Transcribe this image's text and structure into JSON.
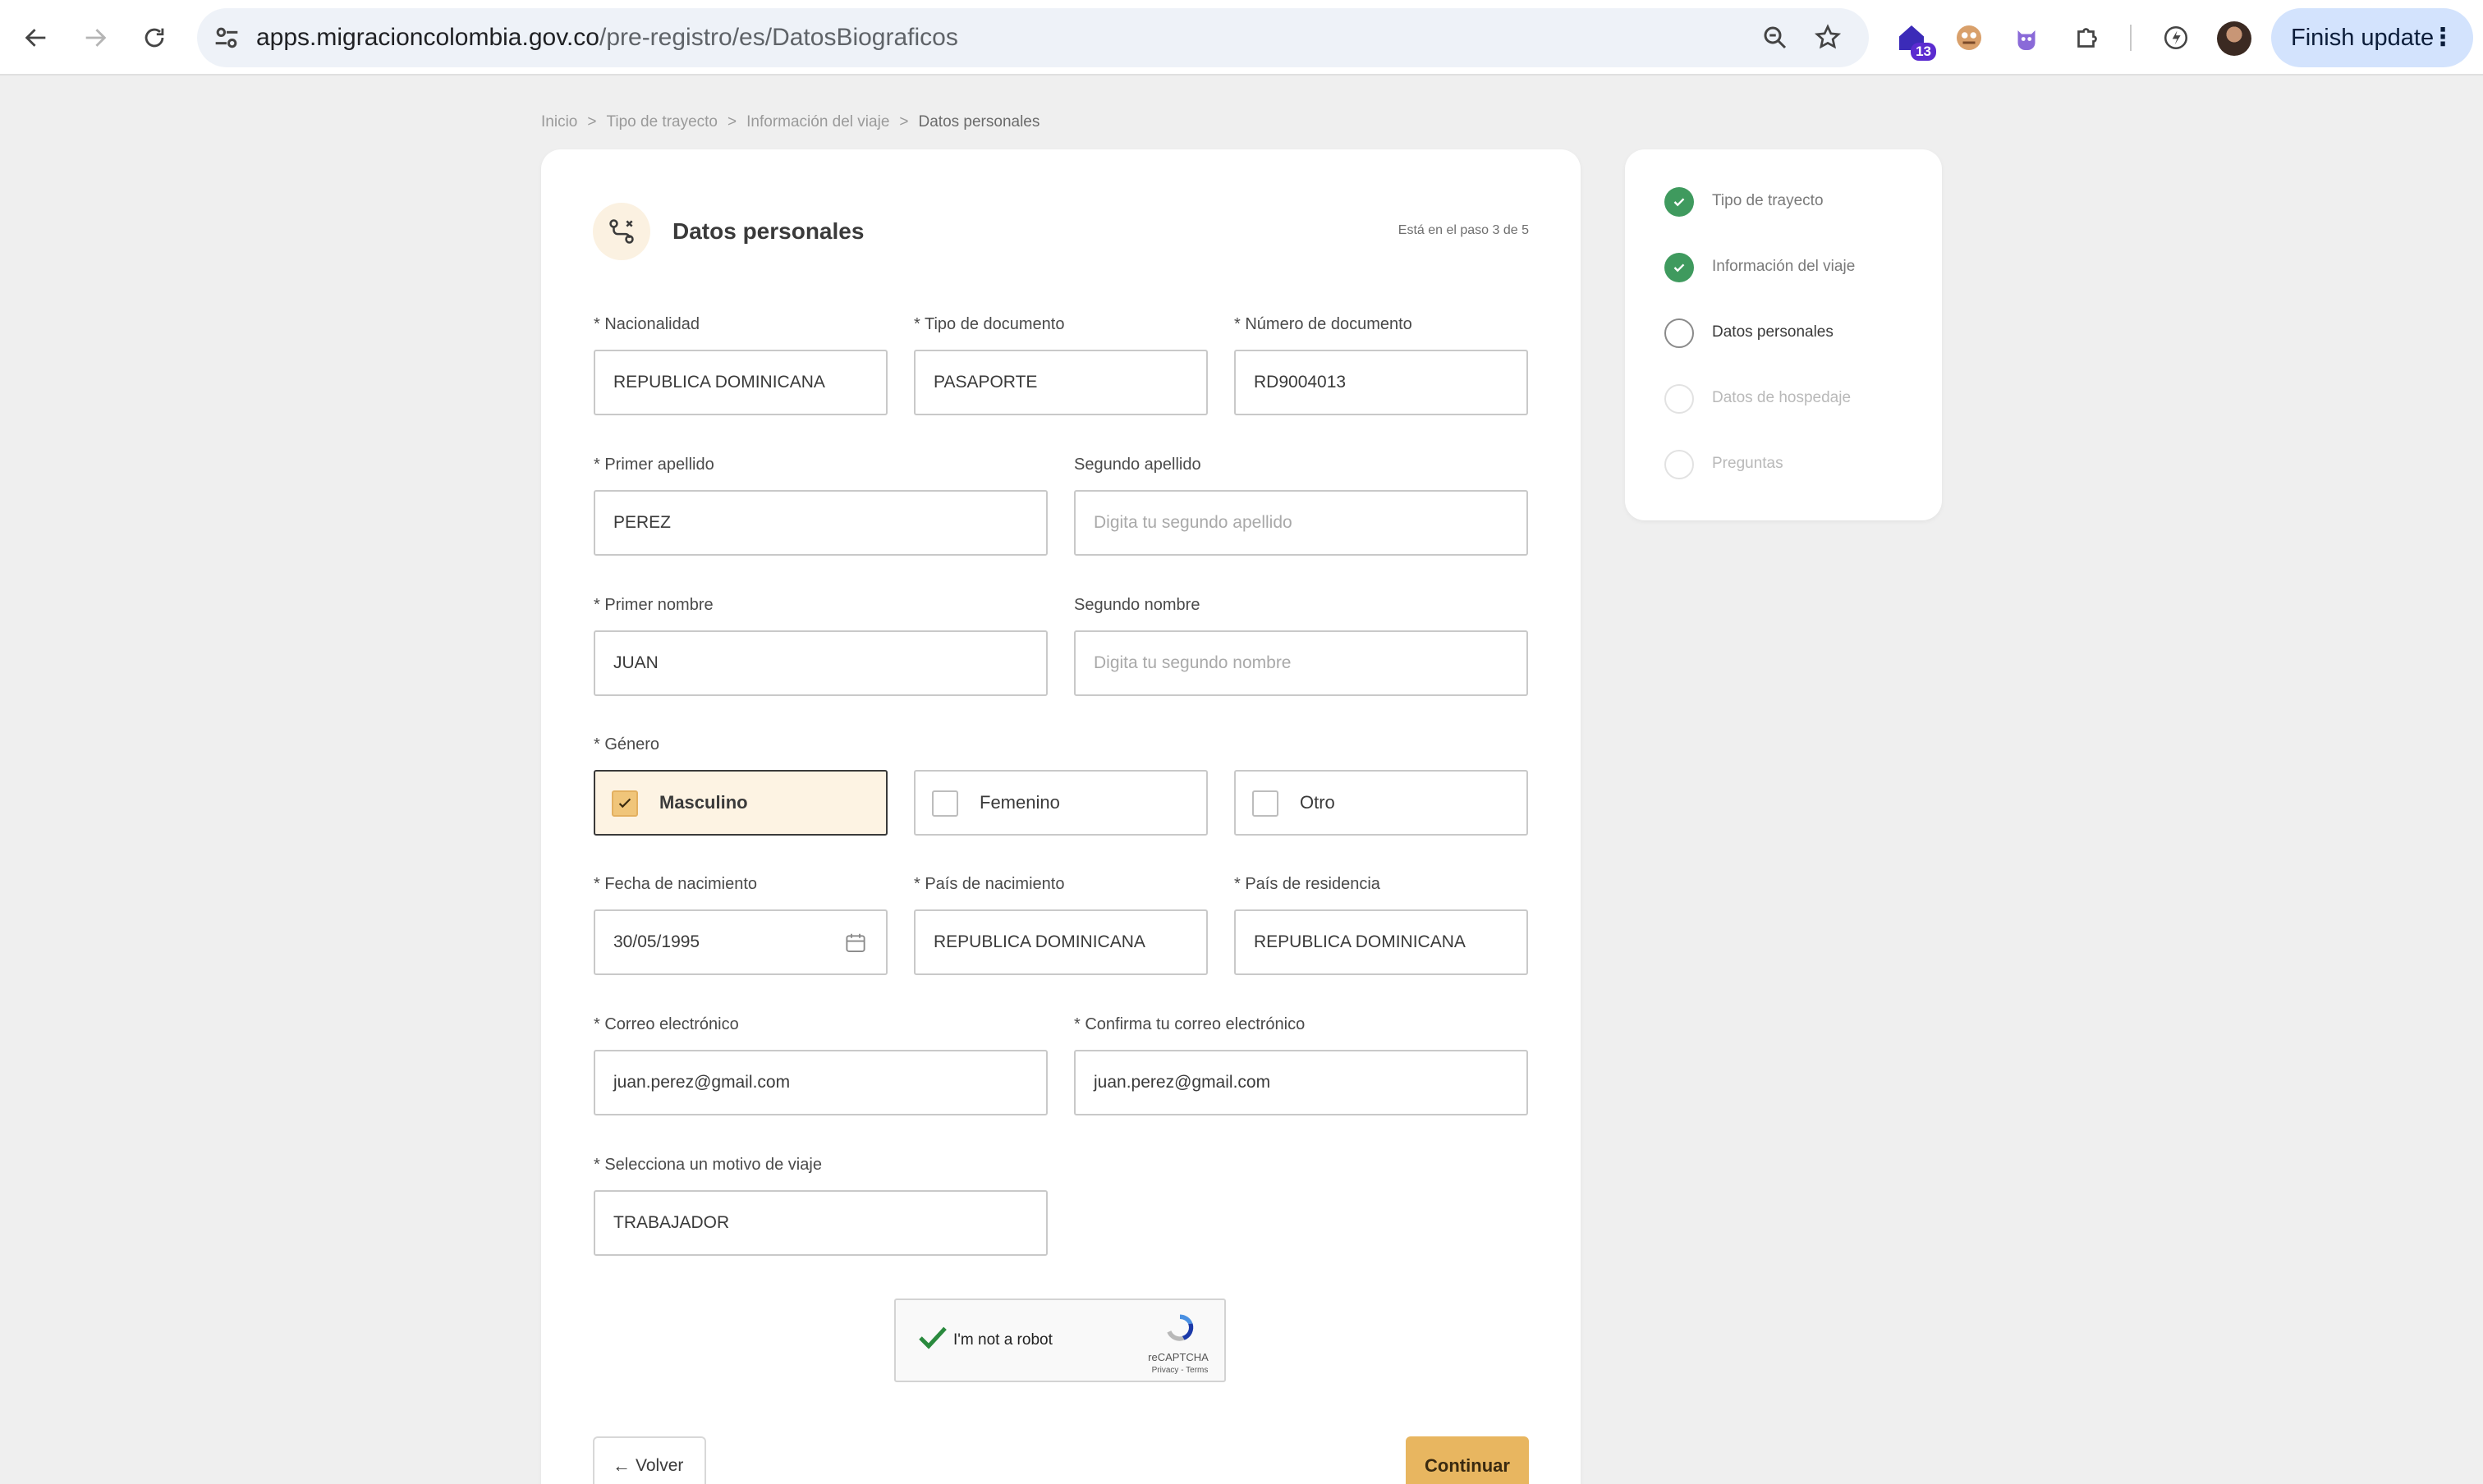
{
  "browser": {
    "url_host": "apps.migracioncolombia.gov.co",
    "url_path": "/pre-registro/es/DatosBiograficos",
    "extension_badge": "13",
    "finish_update_label": "Finish update"
  },
  "breadcrumb": [
    "Inicio",
    "Tipo de trayecto",
    "Información del viaje",
    "Datos personales"
  ],
  "form": {
    "title": "Datos personales",
    "step_indicator": "Está en el paso 3 de 5",
    "fields": {
      "nacionalidad": {
        "label": "* Nacionalidad",
        "value": "REPUBLICA DOMINICANA"
      },
      "tipo_documento": {
        "label": "* Tipo de documento",
        "value": "PASAPORTE"
      },
      "numero_documento": {
        "label": "* Número de documento",
        "value": "RD9004013"
      },
      "primer_apellido": {
        "label": "* Primer apellido",
        "value": "PEREZ"
      },
      "segundo_apellido": {
        "label": "Segundo apellido",
        "placeholder": "Digita tu segundo apellido"
      },
      "primer_nombre": {
        "label": "* Primer nombre",
        "value": "JUAN"
      },
      "segundo_nombre": {
        "label": "Segundo nombre",
        "placeholder": "Digita tu segundo nombre"
      },
      "fecha_nacimiento": {
        "label": "* Fecha de nacimiento",
        "value": "30/05/1995"
      },
      "pais_nacimiento": {
        "label": "* País de nacimiento",
        "value": "REPUBLICA DOMINICANA"
      },
      "pais_residencia": {
        "label": "* País de residencia",
        "value": "REPUBLICA DOMINICANA"
      },
      "correo": {
        "label": "* Correo electrónico",
        "value": "juan.perez@gmail.com"
      },
      "confirma_correo": {
        "label": "* Confirma tu correo electrónico",
        "value": "juan.perez@gmail.com"
      },
      "motivo_viaje": {
        "label": "* Selecciona un motivo de viaje",
        "value": "TRABAJADOR"
      }
    },
    "genero": {
      "label": "* Género",
      "options": [
        "Masculino",
        "Femenino",
        "Otro"
      ],
      "selected": "Masculino"
    },
    "captcha": {
      "text": "I'm not a robot",
      "brand": "reCAPTCHA",
      "terms": "Privacy - Terms"
    },
    "back_label": "Volver",
    "continue_label": "Continuar"
  },
  "steps": [
    {
      "label": "Tipo de trayecto",
      "status": "done"
    },
    {
      "label": "Información del viaje",
      "status": "done"
    },
    {
      "label": "Datos personales",
      "status": "current"
    },
    {
      "label": "Datos de hospedaje",
      "status": "todo"
    },
    {
      "label": "Preguntas",
      "status": "todo"
    }
  ],
  "colors": {
    "accent": "#e8b660",
    "done_green": "#3f9a5e",
    "selected_bg": "#fdf3e3"
  }
}
